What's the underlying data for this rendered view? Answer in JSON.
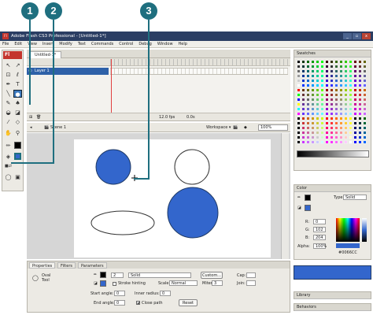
{
  "callouts": [
    "1",
    "2",
    "3"
  ],
  "window": {
    "title": "Adobe Flash CS3 Professional - [Untitled-1*]",
    "app_badge": "Fl",
    "controls": [
      "_",
      "▫",
      "x"
    ]
  },
  "menu": [
    "File",
    "Edit",
    "View",
    "Insert",
    "Modify",
    "Text",
    "Commands",
    "Control",
    "Debug",
    "Window",
    "Help"
  ],
  "tools": {
    "badge": "Fl"
  },
  "document": {
    "tab": "Untitled-1*",
    "layer": "Layer 1",
    "fps": "12.0 fps",
    "time": "0.0s",
    "scene": "Scene 1",
    "workspace": "Workspace ▾",
    "zoom": "100%"
  },
  "properties": {
    "tabs": [
      "Properties",
      "Filters",
      "Parameters"
    ],
    "tool_name": "Oval Tool",
    "stroke_width": "2",
    "stroke_style": "Solid",
    "custom_button": "Custom...",
    "cap_label": "Cap:",
    "stroke_hinting": "Stroke hinting",
    "scale_label": "Scale:",
    "scale_value": "Normal",
    "miter_label": "Miter:",
    "miter_value": "3",
    "join_label": "Join:",
    "start_angle_label": "Start angle:",
    "start_angle": "0",
    "end_angle_label": "End angle:",
    "end_angle": "0",
    "inner_radius_label": "Inner radius:",
    "inner_radius": "0",
    "close_path": "Close path",
    "reset_button": "Reset",
    "fill_color": "#3366CC",
    "stroke_color": "#000000"
  },
  "swatches_panel": {
    "title": "Swatches"
  },
  "color_panel": {
    "title": "Color",
    "type_label": "Type:",
    "type_value": "Solid",
    "r_label": "R:",
    "r": "0",
    "g_label": "G:",
    "g": "102",
    "b_label": "B:",
    "b": "204",
    "alpha_label": "Alpha:",
    "alpha": "100%",
    "hex": "#0066CC"
  },
  "library_panel": {
    "title": "Library"
  },
  "behaviors_panel": {
    "title": "Behaviors"
  },
  "colors": {
    "shape_fill": "#3366CC",
    "callout": "#1f6f7f",
    "titlebar": "#2b3e63"
  }
}
